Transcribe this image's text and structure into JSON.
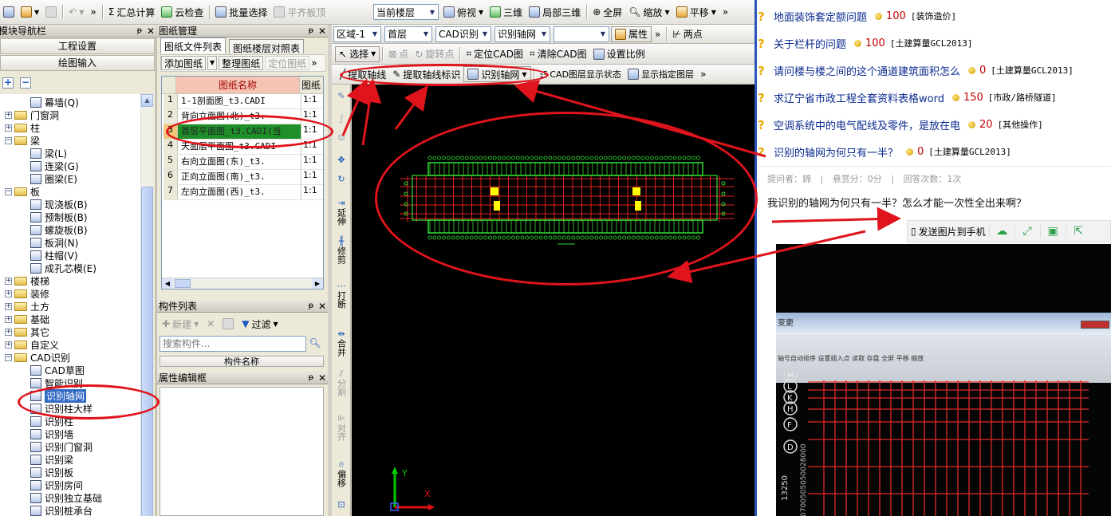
{
  "toolbar1": {
    "sum_calc": "汇总计算",
    "cloud_check": "云检查",
    "batch_select": "批量选择",
    "align_top": "平齐板顶",
    "current_floor": "当前楼层",
    "view": "俯视",
    "three_d": "三维",
    "local_3d": "局部三维",
    "fullscreen": "全屏",
    "zoom": "缩放",
    "pan": "平移"
  },
  "toolbar2": {
    "region": "区域-1",
    "floor": "首层",
    "cad_recog": "CAD识别",
    "recog_axis": "识别轴网",
    "blank_combo": "",
    "properties": "属性",
    "two_point": "两点"
  },
  "toolbar3": {
    "select": "选择",
    "point": "点",
    "rotate_point": "旋转点",
    "locate_cad": "定位CAD图",
    "clear_cad": "清除CAD图",
    "set_scale": "设置比例"
  },
  "toolbar4": {
    "extract_axis": "提取轴线",
    "extract_axis_label": "提取轴线标识",
    "recog_axis": "识别轴网",
    "cad_layer_display": "CAD图层显示状态",
    "show_layer": "显示指定图层"
  },
  "nav": {
    "title": "模块导航栏",
    "project_settings": "工程设置",
    "draw_input": "绘图输入",
    "tree": [
      {
        "label": "幕墙(Q)",
        "type": "leaf"
      },
      {
        "label": "门窗洞",
        "type": "folder"
      },
      {
        "label": "柱",
        "type": "folder"
      },
      {
        "label": "梁",
        "type": "folder-open"
      },
      {
        "label": "梁(L)",
        "type": "leaf"
      },
      {
        "label": "连梁(G)",
        "type": "leaf"
      },
      {
        "label": "圈梁(E)",
        "type": "leaf"
      },
      {
        "label": "板",
        "type": "folder-open"
      },
      {
        "label": "现浇板(B)",
        "type": "leaf"
      },
      {
        "label": "预制板(B)",
        "type": "leaf"
      },
      {
        "label": "螺旋板(B)",
        "type": "leaf"
      },
      {
        "label": "板洞(N)",
        "type": "leaf"
      },
      {
        "label": "柱帽(V)",
        "type": "leaf"
      },
      {
        "label": "成孔芯模(E)",
        "type": "leaf"
      },
      {
        "label": "楼梯",
        "type": "folder"
      },
      {
        "label": "装修",
        "type": "folder"
      },
      {
        "label": "土方",
        "type": "folder"
      },
      {
        "label": "基础",
        "type": "folder"
      },
      {
        "label": "其它",
        "type": "folder"
      },
      {
        "label": "自定义",
        "type": "folder"
      },
      {
        "label": "CAD识别",
        "type": "folder-open"
      },
      {
        "label": "CAD草图",
        "type": "leaf"
      },
      {
        "label": "智能识别",
        "type": "leaf"
      },
      {
        "label": "识别轴网",
        "type": "leaf-selected"
      },
      {
        "label": "识别柱大样",
        "type": "leaf"
      },
      {
        "label": "识别柱",
        "type": "leaf"
      },
      {
        "label": "识别墙",
        "type": "leaf"
      },
      {
        "label": "识别门窗洞",
        "type": "leaf"
      },
      {
        "label": "识别梁",
        "type": "leaf"
      },
      {
        "label": "识别板",
        "type": "leaf"
      },
      {
        "label": "识别房间",
        "type": "leaf"
      },
      {
        "label": "识别独立基础",
        "type": "leaf"
      },
      {
        "label": "识别桩承台",
        "type": "leaf"
      }
    ]
  },
  "drawings": {
    "title": "图纸管理",
    "tab_files": "图纸文件列表",
    "tab_floors": "图纸楼层对照表",
    "add_drawing": "添加图纸",
    "organize": "整理图纸",
    "locate": "定位图纸",
    "col_name": "图纸名称",
    "col_scale": "图纸",
    "rows": [
      {
        "n": "1",
        "name": "1-1剖面图_t3.CADI",
        "scale": "1:1"
      },
      {
        "n": "2",
        "name": "背向立面图(北)_t3.",
        "scale": "1:1"
      },
      {
        "n": "3",
        "name": "首层平面图_t3.CADI(当",
        "scale": "1:1"
      },
      {
        "n": "4",
        "name": "天面层平面图_t3.CADI",
        "scale": "1:1"
      },
      {
        "n": "5",
        "name": "右向立面图(东)_t3.",
        "scale": "1:1"
      },
      {
        "n": "6",
        "name": "正向立面图(南)_t3.",
        "scale": "1:1"
      },
      {
        "n": "7",
        "name": "左向立面图(西)_t3.",
        "scale": "1:1"
      }
    ]
  },
  "components": {
    "title": "构件列表",
    "new": "新建",
    "filter": "过滤",
    "search_placeholder": "搜索构件...",
    "col_name": "构件名称"
  },
  "props": {
    "title": "属性编辑框"
  },
  "vertical_tools": {
    "extend": "延伸",
    "trim": "修剪",
    "break": "打断",
    "merge": "合并",
    "split": "分割",
    "align": "对齐",
    "offset": "偏移"
  },
  "canvas": {
    "axis_y": "Y",
    "axis_x": "X"
  },
  "qa": {
    "questions": [
      {
        "title": "地面装饰套定额问题",
        "points": "100",
        "category": "[装饰造价]"
      },
      {
        "title": "关于栏杆的问题",
        "points": "100",
        "category": "[土建算量GCL2013]"
      },
      {
        "title": "请问楼与楼之间的这个通道建筑面积怎么",
        "points": "0",
        "category": "[土建算量GCL2013]"
      },
      {
        "title": "求辽宁省市政工程全套资料表格word",
        "points": "150",
        "category": "[市政/路桥隧道]"
      },
      {
        "title": "空调系统中的电气配线及零件，是放在电",
        "points": "20",
        "category": "[其他操作]"
      },
      {
        "title": "识别的轴网为何只有一半？",
        "points": "0",
        "category": "[土建算量GCL2013]"
      }
    ],
    "meta_asker": "提问者：",
    "meta_asker_name": "鍗",
    "meta_reward": "悬赏分：0分",
    "meta_answers": "回答次数：1次",
    "question_body": "我识别的轴网为何只有一半？怎么才能一次性全出来啊？",
    "send_to_phone": "发送图片到手机",
    "photo_menu_title": "变更",
    "photo_toolbar": "轴号自动排序  设置插入点  读取  存盘  全屏  平移  缩放",
    "photo_axis_labels": [
      "M",
      "L",
      "K",
      "H",
      "F",
      "D"
    ],
    "photo_dim": "13250",
    "photo_dim2": "0700505050028000"
  }
}
